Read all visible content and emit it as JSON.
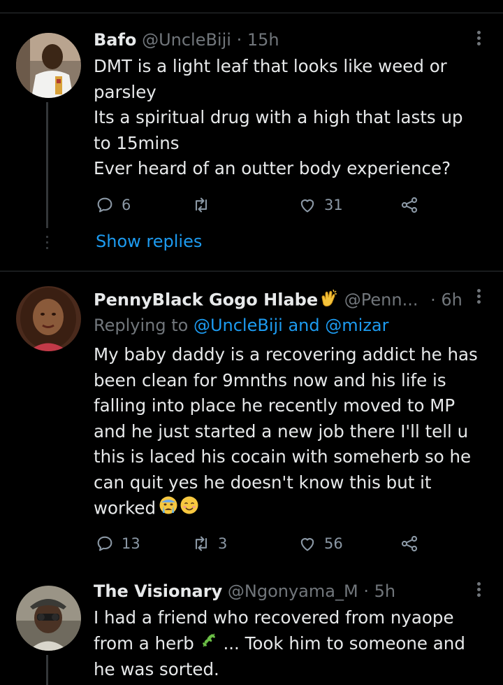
{
  "tweets": [
    {
      "name": "Bafo",
      "handle": "@UncleBiji",
      "sep": "·",
      "time": "15h",
      "lines": [
        "DMT is a light leaf that looks like weed or",
        "parsley",
        "Its a spiritual drug with a high that lasts up",
        "to 15mins",
        "Ever heard of an outter body experience?"
      ],
      "replies": "6",
      "retweets": "",
      "likes": "31",
      "show_replies": "Show replies"
    },
    {
      "name": "PennyBlack Gogo Hlabe",
      "handle": "@Penn...",
      "sep": "·",
      "time": "6h",
      "replying_prefix": "Replying to",
      "replying_to_1": "@UncleBiji",
      "replying_and": "and",
      "replying_to_2": "@mizar",
      "lines": [
        "My baby daddy is a recovering addict he has",
        "been clean for 9mnths now and his life is",
        "falling into place he recently moved to MP",
        "and he just started a new job there I'll tell u",
        "this is laced his cocain with someherb so he",
        "can quit  yes he doesn't know this but it",
        "worked"
      ],
      "replies": "13",
      "retweets": "3",
      "likes": "56"
    },
    {
      "name": "The Visionary",
      "handle": "@Ngonyama_M",
      "sep": "·",
      "time": "5h",
      "lines": [
        "I had a friend who recovered from nyaope",
        "from a herb",
        "... Took him to someone and",
        "he was sorted."
      ]
    }
  ],
  "icons": [
    "reply-icon",
    "retweet-icon",
    "like-icon",
    "share-icon",
    "more-icon",
    "clapping-hands-emoji",
    "crying-face-emoji",
    "smiling-face-emoji",
    "herb-emoji"
  ],
  "colors": {
    "background": "#000000",
    "text": "#e7e9ea",
    "muted": "#71767b",
    "link": "#1d9bf0"
  }
}
